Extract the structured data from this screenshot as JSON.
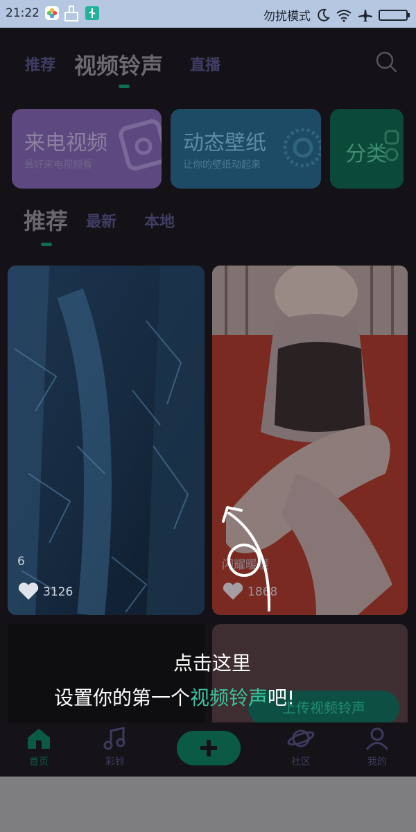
{
  "status_bar": {
    "time": "21:22",
    "mode": "勿扰模式"
  },
  "header": {
    "tabs": [
      {
        "label": "推荐"
      },
      {
        "label": "视频铃声"
      },
      {
        "label": "直播"
      }
    ]
  },
  "categories": [
    {
      "title": "来电视频",
      "subtitle": "最好来电视频看"
    },
    {
      "title": "动态壁纸",
      "subtitle": "让你的壁纸动起来"
    },
    {
      "title": "分类",
      "subtitle": ""
    }
  ],
  "sub_tabs": [
    {
      "label": "推荐"
    },
    {
      "label": "最新"
    },
    {
      "label": "本地"
    }
  ],
  "cards": [
    {
      "title": "6",
      "likes": "3126"
    },
    {
      "title": "闪耀暖暖",
      "likes": "1868"
    }
  ],
  "upload_button": {
    "label": "上传视频铃声"
  },
  "hint": {
    "line1": "点击这里",
    "line2_prefix": "设置你的第一个",
    "line2_highlight": "视频铃声",
    "line2_suffix": "吧!"
  },
  "bottom_nav": [
    {
      "label": "首页"
    },
    {
      "label": "彩铃"
    },
    {
      "label": "社区"
    },
    {
      "label": "我的"
    }
  ],
  "colors": {
    "accent": "#0f6d55",
    "highlight": "#3ec29c",
    "app_bg": "#141216"
  }
}
